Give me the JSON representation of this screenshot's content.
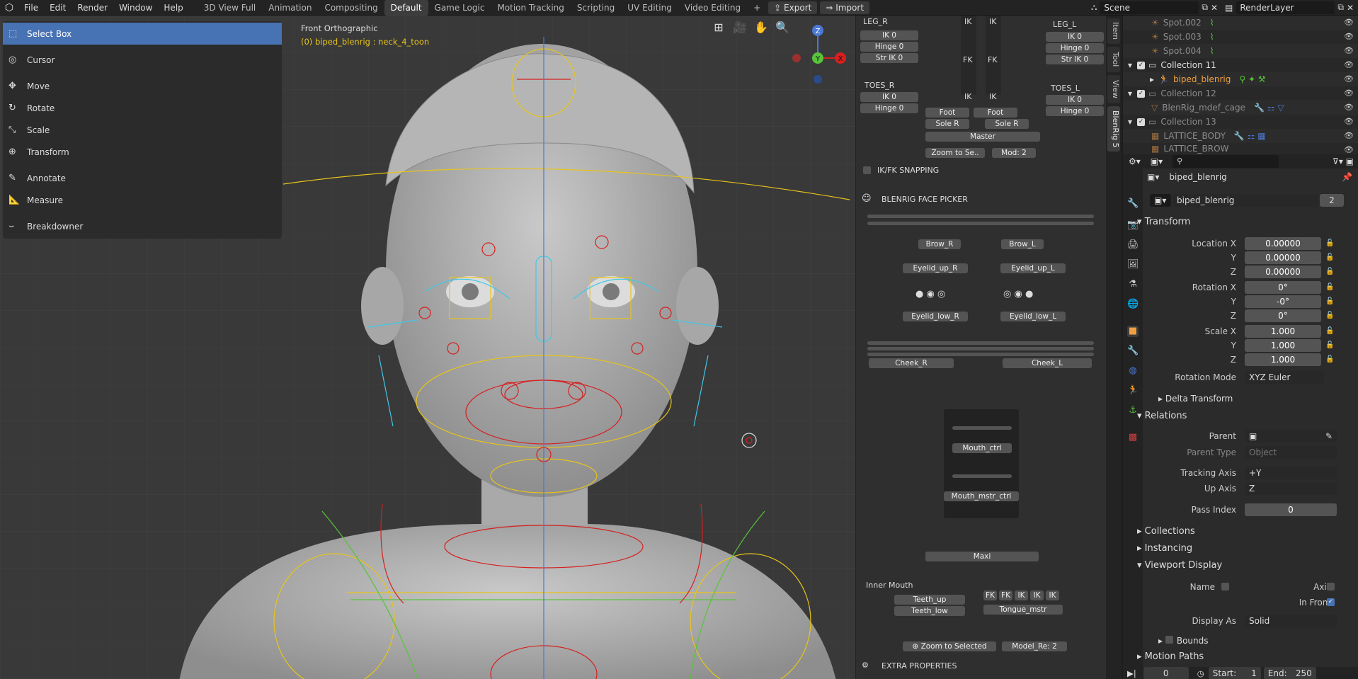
{
  "menu": {
    "file": "File",
    "edit": "Edit",
    "render": "Render",
    "window": "Window",
    "help": "Help"
  },
  "workspaces": [
    "3D View Full",
    "Animation",
    "Compositing",
    "Default",
    "Game Logic",
    "Motion Tracking",
    "Scripting",
    "UV Editing",
    "Video Editing"
  ],
  "active_workspace": "Default",
  "add_ws": "+",
  "export_label": "Export",
  "import_label": "Import",
  "scene": "Scene",
  "render_layer": "RenderLayer",
  "tools": [
    {
      "label": "Select Box",
      "icon": "⬚"
    },
    {
      "label": "Cursor",
      "icon": "◎"
    },
    {
      "label": "Move",
      "icon": "✥"
    },
    {
      "label": "Rotate",
      "icon": "↻"
    },
    {
      "label": "Scale",
      "icon": "⤡"
    },
    {
      "label": "Transform",
      "icon": "⊕"
    },
    {
      "label": "Annotate",
      "icon": "✎"
    },
    {
      "label": "Measure",
      "icon": "📐"
    },
    {
      "label": "Breakdowner",
      "icon": "⌣"
    }
  ],
  "viewport": {
    "view_name": "Front Orthographic",
    "object_info": "(0) biped_blenrig : neck_4_toon"
  },
  "gizmo": {
    "z": "Z",
    "y": "Y",
    "x": "X"
  },
  "npanel": {
    "leg_r": "LEG_R",
    "leg_l": "LEG_L",
    "ik0": "IK 0",
    "hinge0": "Hinge 0",
    "strik0": "Str IK 0",
    "toes_r": "TOES_R",
    "toes_l": "TOES_L",
    "ik": "IK",
    "fk": "FK",
    "foot": "Foot",
    "sole_r": "Sole R",
    "master": "Master",
    "zoom_sel": "Zoom to Se..",
    "mod": "Mod: 2",
    "ikfk_snapping": "IK/FK SNAPPING",
    "face_picker": "BLENRIG FACE PICKER",
    "brow_r": "Brow_R",
    "brow_l": "Brow_L",
    "eyelid_up_r": "Eyelid_up_R",
    "eyelid_up_l": "Eyelid_up_L",
    "eyelid_low_r": "Eyelid_low_R",
    "eyelid_low_l": "Eyelid_low_L",
    "cheek_r": "Cheek_R",
    "cheek_l": "Cheek_L",
    "mouth_ctrl": "Mouth_ctrl",
    "mouth_mstr": "Mouth_mstr_ctrl",
    "maxi": "Maxi",
    "inner_mouth": "Inner Mouth",
    "teeth_up": "Teeth_up",
    "teeth_low": "Teeth_low",
    "tongue": "Tongue_mstr",
    "fk_ik_row": [
      "FK",
      "FK",
      "IK",
      "IK",
      "IK"
    ],
    "zoom_selected": "Zoom to Selected",
    "model_re": "Model_Re: 2",
    "extra": "EXTRA PROPERTIES"
  },
  "vtabs": [
    "Item",
    "Tool",
    "View",
    "BlenRig 5"
  ],
  "outliner": [
    {
      "name": "Spot.002",
      "indent": 3
    },
    {
      "name": "Spot.003",
      "indent": 3
    },
    {
      "name": "Spot.004",
      "indent": 3
    },
    {
      "name": "Collection 11",
      "indent": 1,
      "collection": true
    },
    {
      "name": "biped_blenrig",
      "indent": 2,
      "active": true
    },
    {
      "name": "Collection 12",
      "indent": 1,
      "collection": true,
      "dim": true
    },
    {
      "name": "BlenRig_mdef_cage",
      "indent": 2,
      "dim": true
    },
    {
      "name": "Collection 13",
      "indent": 1,
      "collection": true,
      "dim": true
    },
    {
      "name": "LATTICE_BODY",
      "indent": 2,
      "dim": true
    },
    {
      "name": "LATTICE_BROW",
      "indent": 2,
      "dim": true
    }
  ],
  "props": {
    "object_name": "biped_blenrig",
    "datablock": "biped_blenrig",
    "users": "2",
    "transform": "Transform",
    "location_x": "Location X",
    "y": "Y",
    "z": "Z",
    "loc": [
      "0.00000",
      "0.00000",
      "0.00000"
    ],
    "rotation_x": "Rotation X",
    "rot": [
      "0°",
      "-0°",
      "0°"
    ],
    "scale_x": "Scale X",
    "scale": [
      "1.000",
      "1.000",
      "1.000"
    ],
    "rotation_mode": "Rotation Mode",
    "rotation_mode_val": "XYZ Euler",
    "delta": "Delta Transform",
    "relations": "Relations",
    "parent": "Parent",
    "parent_type": "Parent Type",
    "parent_type_val": "Object",
    "tracking_axis": "Tracking Axis",
    "tracking_axis_val": "+Y",
    "up_axis": "Up Axis",
    "up_axis_val": "Z",
    "pass_index": "Pass Index",
    "pass_index_val": "0",
    "collections": "Collections",
    "instancing": "Instancing",
    "viewport_display": "Viewport Display",
    "name": "Name",
    "axis": "Axis",
    "in_front": "In Front",
    "display_as": "Display As",
    "display_as_val": "Solid",
    "bounds": "Bounds",
    "motion_paths": "Motion Paths"
  },
  "status": {
    "frame": "0",
    "start_label": "Start:",
    "start": "1",
    "end_label": "End:",
    "end": "250"
  },
  "colors": {
    "accent": "#4772b3",
    "bone_yellow": "#e8c419",
    "bone_red": "#d62020",
    "bone_cyan": "#40c8e8",
    "bone_green": "#57c43a",
    "active_orange": "#f0a040"
  }
}
